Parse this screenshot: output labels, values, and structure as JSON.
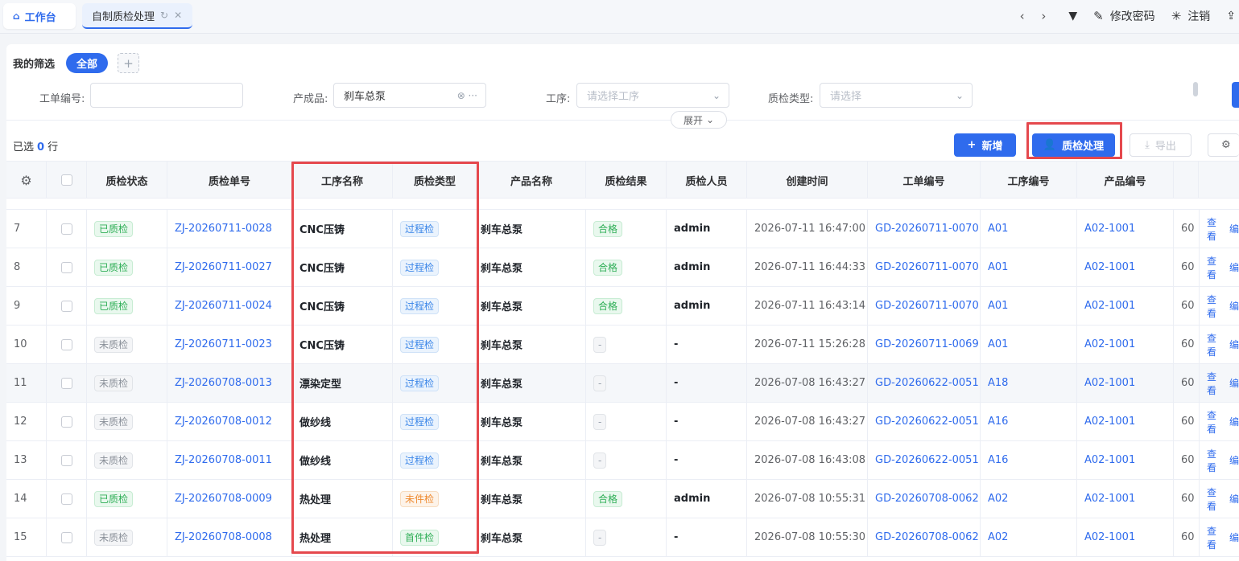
{
  "tabs": {
    "home_label": "工作台",
    "active_label": "自制质检处理"
  },
  "top_right": {
    "change_password": "修改密码",
    "logout": "注销"
  },
  "filter": {
    "title": "我的筛选",
    "chip_all": "全部",
    "chip_add": "+",
    "fields": {
      "order_no_label": "工单编号:",
      "order_no_value": "",
      "product_label": "产成品:",
      "product_value": "刹车总泵",
      "process_label": "工序:",
      "process_placeholder": "请选择工序",
      "qc_type_label": "质检类型:",
      "qc_type_placeholder": "请选择"
    },
    "expand_label": "展开"
  },
  "toolbar": {
    "selected_prefix": "已选",
    "selected_count": "0",
    "selected_suffix": "行",
    "add_label": "新增",
    "qc_label": "质检处理",
    "export_label": "导出"
  },
  "table": {
    "headers": [
      "质检状态",
      "质检单号",
      "工序名称",
      "质检类型",
      "产品名称",
      "质检结果",
      "质检人员",
      "创建时间",
      "工单编号",
      "工序编号",
      "产品编号"
    ],
    "action_view": "查看",
    "action_edit": "编",
    "rows": [
      {
        "idx": "7",
        "status": "已质检",
        "qc_no": "ZJ-20260711-0028",
        "process": "CNC压铸",
        "type": "过程检",
        "product": "刹车总泵",
        "result": "合格",
        "inspector": "admin",
        "created": "2026-07-11 16:47:00",
        "order_no": "GD-20260711-0070",
        "process_no": "A01",
        "product_no": "A02-1001",
        "extra": "60"
      },
      {
        "idx": "8",
        "status": "已质检",
        "qc_no": "ZJ-20260711-0027",
        "process": "CNC压铸",
        "type": "过程检",
        "product": "刹车总泵",
        "result": "合格",
        "inspector": "admin",
        "created": "2026-07-11 16:44:33",
        "order_no": "GD-20260711-0070",
        "process_no": "A01",
        "product_no": "A02-1001",
        "extra": "60"
      },
      {
        "idx": "9",
        "status": "已质检",
        "qc_no": "ZJ-20260711-0024",
        "process": "CNC压铸",
        "type": "过程检",
        "product": "刹车总泵",
        "result": "合格",
        "inspector": "admin",
        "created": "2026-07-11 16:43:14",
        "order_no": "GD-20260711-0070",
        "process_no": "A01",
        "product_no": "A02-1001",
        "extra": "60"
      },
      {
        "idx": "10",
        "status": "未质检",
        "qc_no": "ZJ-20260711-0023",
        "process": "CNC压铸",
        "type": "过程检",
        "product": "刹车总泵",
        "result": "-",
        "inspector": "-",
        "created": "2026-07-11 15:26:28",
        "order_no": "GD-20260711-0069",
        "process_no": "A01",
        "product_no": "A02-1001",
        "extra": "60"
      },
      {
        "idx": "11",
        "status": "未质检",
        "qc_no": "ZJ-20260708-0013",
        "process": "漂染定型",
        "type": "过程检",
        "product": "刹车总泵",
        "result": "-",
        "inspector": "-",
        "created": "2026-07-08 16:43:27",
        "order_no": "GD-20260622-0051",
        "process_no": "A18",
        "product_no": "A02-1001",
        "extra": "60"
      },
      {
        "idx": "12",
        "status": "未质检",
        "qc_no": "ZJ-20260708-0012",
        "process": "做纱线",
        "type": "过程检",
        "product": "刹车总泵",
        "result": "-",
        "inspector": "-",
        "created": "2026-07-08 16:43:27",
        "order_no": "GD-20260622-0051",
        "process_no": "A16",
        "product_no": "A02-1001",
        "extra": "60"
      },
      {
        "idx": "13",
        "status": "未质检",
        "qc_no": "ZJ-20260708-0011",
        "process": "做纱线",
        "type": "过程检",
        "product": "刹车总泵",
        "result": "-",
        "inspector": "-",
        "created": "2026-07-08 16:43:08",
        "order_no": "GD-20260622-0051",
        "process_no": "A16",
        "product_no": "A02-1001",
        "extra": "60"
      },
      {
        "idx": "14",
        "status": "已质检",
        "qc_no": "ZJ-20260708-0009",
        "process": "热处理",
        "type": "未件检",
        "product": "刹车总泵",
        "result": "合格",
        "inspector": "admin",
        "created": "2026-07-08 10:55:31",
        "order_no": "GD-20260708-0062",
        "process_no": "A02",
        "product_no": "A02-1001",
        "extra": "60"
      },
      {
        "idx": "15",
        "status": "未质检",
        "qc_no": "ZJ-20260708-0008",
        "process": "热处理",
        "type": "首件检",
        "product": "刹车总泵",
        "result": "-",
        "inspector": "-",
        "created": "2026-07-08 10:55:30",
        "order_no": "GD-20260708-0062",
        "process_no": "A02",
        "product_no": "A02-1001",
        "extra": "60"
      }
    ]
  },
  "colors": {
    "primary": "#2f6bed",
    "highlight_box": "#e5484d",
    "pass_green": "#2eae56"
  }
}
